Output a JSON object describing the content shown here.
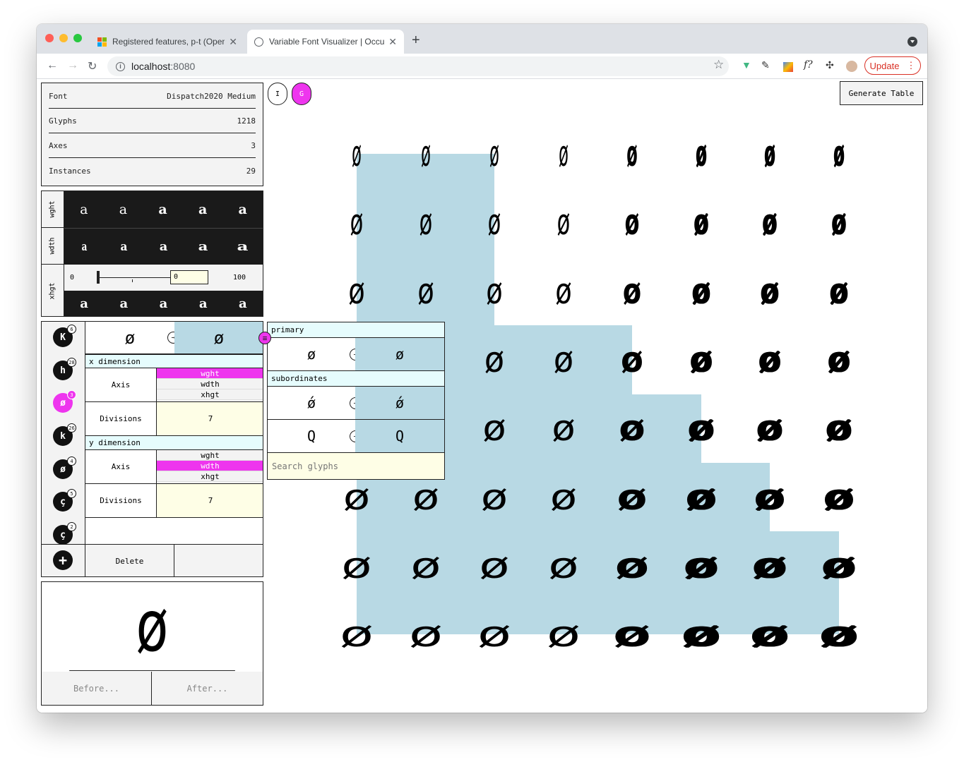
{
  "browser": {
    "tabs": [
      {
        "title": "Registered features, p-t (OpenT",
        "active": false
      },
      {
        "title": "Variable Font Visualizer | Occu",
        "active": true
      }
    ],
    "url_host": "localhost",
    "url_port": ":8080",
    "update_label": "Update"
  },
  "colors": {
    "accent": "#ee35ee",
    "highlight": "#b8d9e4",
    "header": "#e6fcfd",
    "input": "#fefee6"
  },
  "info": [
    {
      "label": "Font",
      "value": "Dispatch2020 Medium"
    },
    {
      "label": "Glyphs",
      "value": "1218"
    },
    {
      "label": "Axes",
      "value": "3"
    },
    {
      "label": "Instances",
      "value": "29"
    }
  ],
  "axes": {
    "wght_label": "wght",
    "wdth_label": "wdth",
    "xhgt_label": "xhgt",
    "sample_char": "a",
    "slider_min": "0",
    "slider_max": "100",
    "slider_value": "0"
  },
  "mode_buttons": {
    "i": "I",
    "g": "G"
  },
  "generate_label": "Generate Table",
  "glyph_list": [
    {
      "char": "K",
      "count": "6"
    },
    {
      "char": "h",
      "count": "28"
    },
    {
      "char": "ø",
      "count": "3"
    },
    {
      "char": "k",
      "count": "26"
    },
    {
      "char": "ø",
      "count": "4"
    },
    {
      "char": "ç",
      "count": "5"
    },
    {
      "char": "ç",
      "count": "2"
    }
  ],
  "editor": {
    "from_glyph": "ø",
    "to_glyph": "ø",
    "x_dimension_label": "x dimension",
    "y_dimension_label": "y dimension",
    "axis_label": "Axis",
    "divisions_label": "Divisions",
    "axis_options": [
      "wght",
      "wdth",
      "xhgt"
    ],
    "x_selected": "wght",
    "y_selected": "wdth",
    "x_divisions": "7",
    "y_divisions": "7",
    "delete_label": "Delete"
  },
  "popup": {
    "primary_label": "primary",
    "primary_from": "ø",
    "primary_to": "ø",
    "subordinates_label": "subordinates",
    "subordinates": [
      {
        "from": "ǿ",
        "to": "ǿ"
      },
      {
        "from": "Q",
        "to": "Q"
      }
    ],
    "search_placeholder": "Search glyphs"
  },
  "preview": {
    "glyph": "ø",
    "before_label": "Before...",
    "after_label": "After..."
  },
  "grid": {
    "glyph": "ø",
    "rows": 8,
    "cols": 8,
    "highlight_cols_per_row": [
      3,
      3,
      3,
      5,
      6,
      7,
      8,
      8
    ]
  }
}
